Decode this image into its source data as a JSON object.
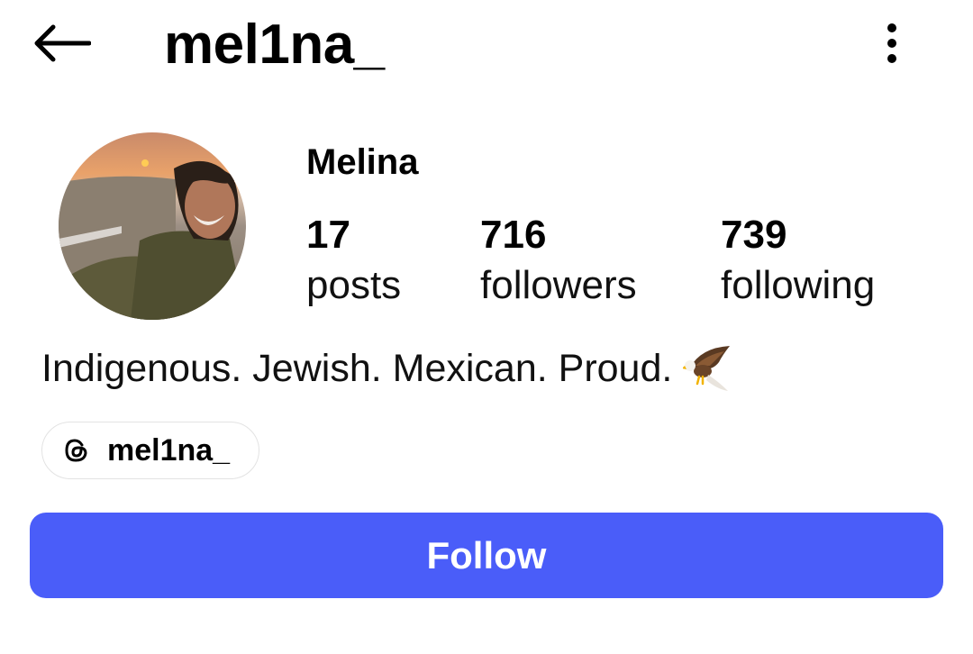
{
  "header": {
    "username": "mel1na_",
    "back_icon": "arrow-left-icon",
    "more_icon": "more-vertical-icon"
  },
  "profile": {
    "display_name": "Melina",
    "avatar_icon": "profile-photo",
    "stats": [
      {
        "value": "17",
        "label": "posts"
      },
      {
        "value": "716",
        "label": "followers"
      },
      {
        "value": "739",
        "label": "following"
      }
    ],
    "bio": "Indigenous. Jewish. Mexican. Proud.",
    "bio_emoji": "eagle-emoji"
  },
  "threads_link": {
    "icon": "threads-icon",
    "label": "mel1na_"
  },
  "follow_button": {
    "label": "Follow",
    "color": "#4a5df9"
  }
}
